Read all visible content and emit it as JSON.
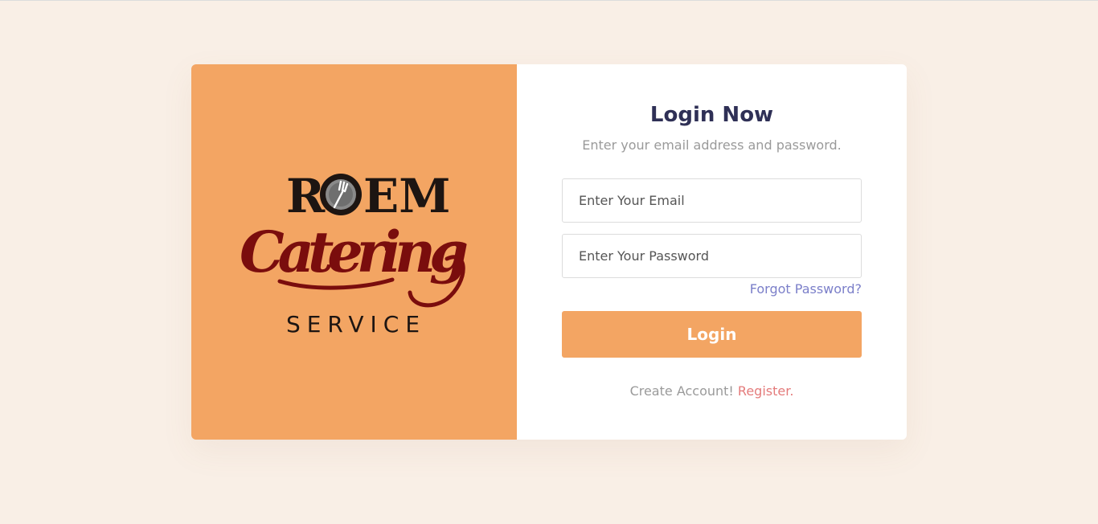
{
  "brand": {
    "logo_name": "ROEM Catering SERVICE",
    "logo_top": "ROEM",
    "logo_script": "Catering",
    "logo_bottom": "SERVICE",
    "panel_color": "#f3a563"
  },
  "login": {
    "title": "Login Now",
    "subtitle": "Enter your email address and password.",
    "email_placeholder": "Enter Your Email",
    "password_placeholder": "Enter Your Password",
    "forgot_label": "Forgot Password?",
    "button_label": "Login",
    "register_prompt": "Create Account!",
    "register_label": "Register.",
    "accent_color": "#f3a563",
    "link_color": "#7b7fc9",
    "register_color": "#e47b7b"
  }
}
